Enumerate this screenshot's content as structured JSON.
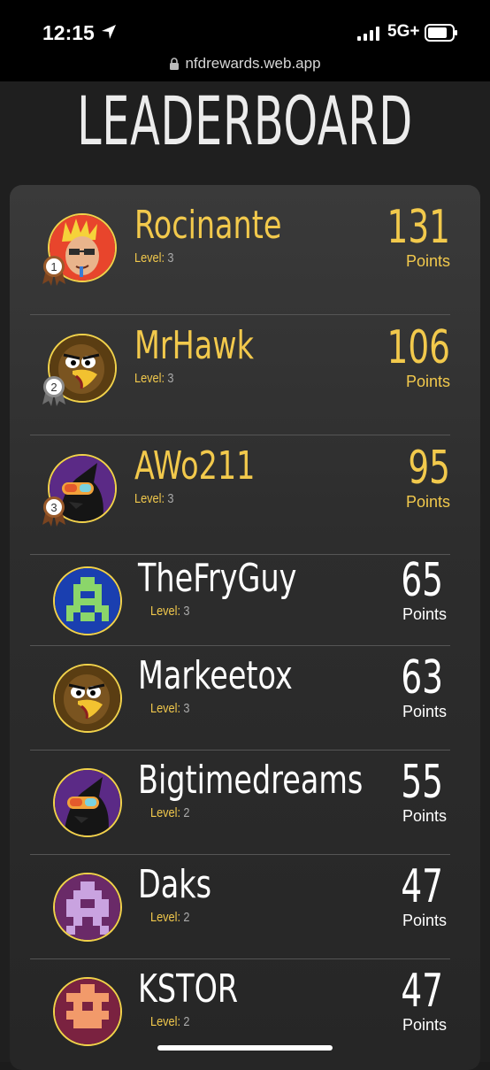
{
  "status_bar": {
    "time": "12:15",
    "network": "5G+"
  },
  "browser": {
    "url": "nfdrewards.web.app"
  },
  "page_title": "LEADERBOARD",
  "points_label": "Points",
  "level_label": "Level:",
  "colors": {
    "gold": "#f2c94c",
    "background": "#1f1f1f",
    "card": "#2d2d2d"
  },
  "leaderboard": [
    {
      "rank": "1",
      "name": "Rocinante",
      "level": "3",
      "points": "131",
      "avatar": "blond-character-avatar"
    },
    {
      "rank": "2",
      "name": "MrHawk",
      "level": "3",
      "points": "106",
      "avatar": "hawk-avatar"
    },
    {
      "rank": "3",
      "name": "AWo211",
      "level": "3",
      "points": "95",
      "avatar": "goggles-avatar"
    },
    {
      "rank": "",
      "name": "TheFryGuy",
      "level": "3",
      "points": "65",
      "avatar": "green-pixel-avatar"
    },
    {
      "rank": "",
      "name": "Markeetox",
      "level": "3",
      "points": "63",
      "avatar": "hawk-avatar"
    },
    {
      "rank": "",
      "name": "Bigtimedreams",
      "level": "2",
      "points": "55",
      "avatar": "goggles-avatar"
    },
    {
      "rank": "",
      "name": "Daks",
      "level": "2",
      "points": "47",
      "avatar": "purple-pixel-avatar"
    },
    {
      "rank": "",
      "name": "KSTOR",
      "level": "2",
      "points": "47",
      "avatar": "orange-pixel-avatar"
    }
  ]
}
